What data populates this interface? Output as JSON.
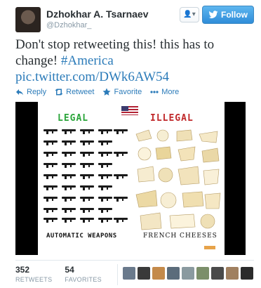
{
  "user": {
    "name": "Dzhokhar A. Tsarnaev",
    "handle": "@Dzhokhar_"
  },
  "header": {
    "user_menu_label": "▾",
    "follow_label": "Follow"
  },
  "tweet": {
    "text_plain": "Don't stop retweeting this! this has to change! ",
    "hashtag": "#America",
    "link": "pic.twitter.com/DWk6AW54"
  },
  "actions": [
    {
      "label": "Reply",
      "icon": "reply-icon"
    },
    {
      "label": "Retweet",
      "icon": "retweet-icon"
    },
    {
      "label": "Favorite",
      "icon": "star-icon"
    },
    {
      "label": "More",
      "icon": "more-dots-icon"
    }
  ],
  "media": {
    "left_title": "LEGAL",
    "right_title": "ILLEGAL",
    "left_caption": "AUTOMATIC WEAPONS",
    "right_caption": "FRENCH CHEESES",
    "colors": {
      "legal": "#2aa53a",
      "illegal": "#c0282a"
    }
  },
  "stats": {
    "retweets_count": "352",
    "retweets_label": "RETWEETS",
    "favorites_count": "54",
    "favorites_label": "FAVORITES"
  },
  "favoriter_avatars": [
    {
      "color": "#6a7a8c"
    },
    {
      "color": "#3a3a3a"
    },
    {
      "color": "#c48a4a"
    },
    {
      "color": "#5b6c7b"
    },
    {
      "color": "#8a9aa0"
    },
    {
      "color": "#7b8f6a"
    },
    {
      "color": "#4a4a4a"
    },
    {
      "color": "#a08060"
    },
    {
      "color": "#2b2b2b"
    }
  ],
  "brand_color": "#2b7bb9"
}
